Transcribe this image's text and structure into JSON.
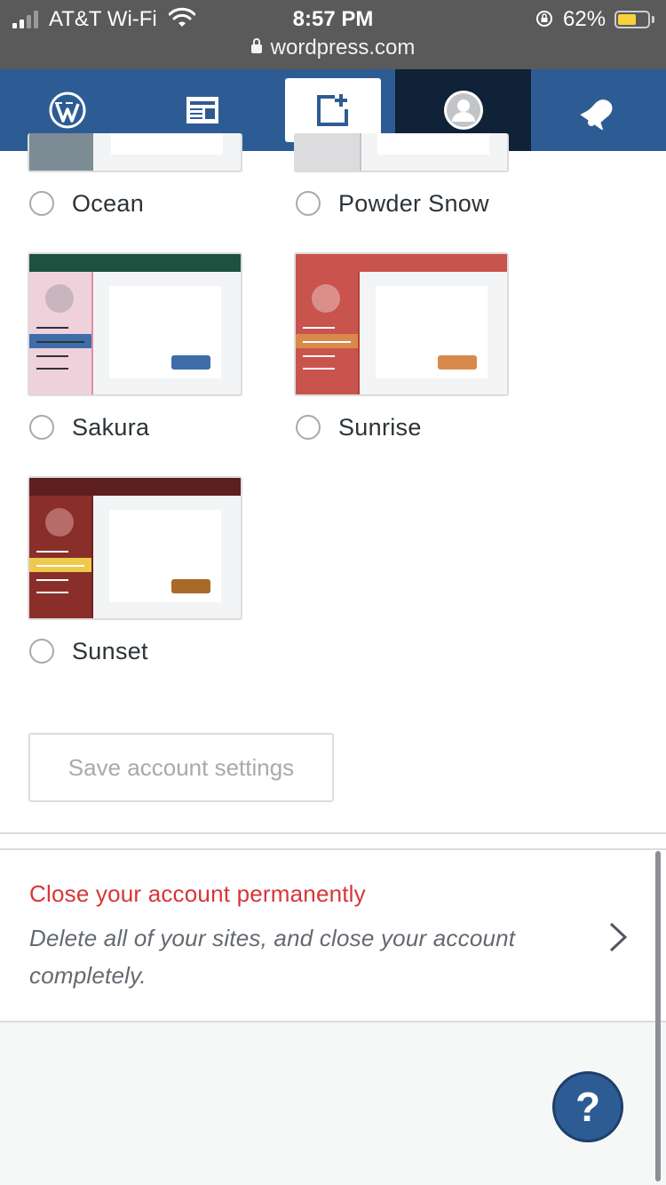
{
  "status_bar": {
    "carrier": "AT&T Wi-Fi",
    "time": "8:57 PM",
    "battery_percent": "62%",
    "battery_level": 0.62,
    "url": "wordpress.com"
  },
  "nav": {
    "icons": [
      "wordpress-logo-icon",
      "reader-icon",
      "new-post-icon",
      "user-avatar-icon",
      "notifications-bell-icon"
    ],
    "active_item": "new-post"
  },
  "color_schemes": [
    {
      "label": "Ocean",
      "side": "#7d8b95",
      "header": "#7d8b95",
      "accent": "#7d8b95",
      "button": "#7d8b95",
      "avatar": "#aab4bb"
    },
    {
      "label": "Powder Snow",
      "side": "#dcdcde",
      "header": "#dcdcde",
      "accent": "#dcdcde",
      "button": "#dcdcde",
      "avatar": "#eee"
    },
    {
      "label": "Sakura",
      "header": "#1f5140",
      "side": "#efd1dc",
      "accent": "#3e6da9",
      "button": "#3e6da9",
      "avatar": "#c8b5bd",
      "lines": "#2c3338",
      "border": "#e28ea6"
    },
    {
      "label": "Sunrise",
      "header": "#c8544d",
      "side": "#c8544d",
      "accent": "#d98a4b",
      "button": "#d98a4b",
      "avatar": "#db8f8a",
      "lines": "#ffffff",
      "border": "#b34039"
    },
    {
      "label": "Sunset",
      "header": "#5d1f1f",
      "side": "#8a2e2a",
      "accent": "#efc94c",
      "button": "#a86a27",
      "avatar": "#b66c68",
      "lines": "#ffffff",
      "border": "#6b2420"
    }
  ],
  "save_button": "Save account settings",
  "close_account": {
    "title": "Close your account permanently",
    "description": "Delete all of your sites, and close your account completely."
  },
  "help_button": "?"
}
